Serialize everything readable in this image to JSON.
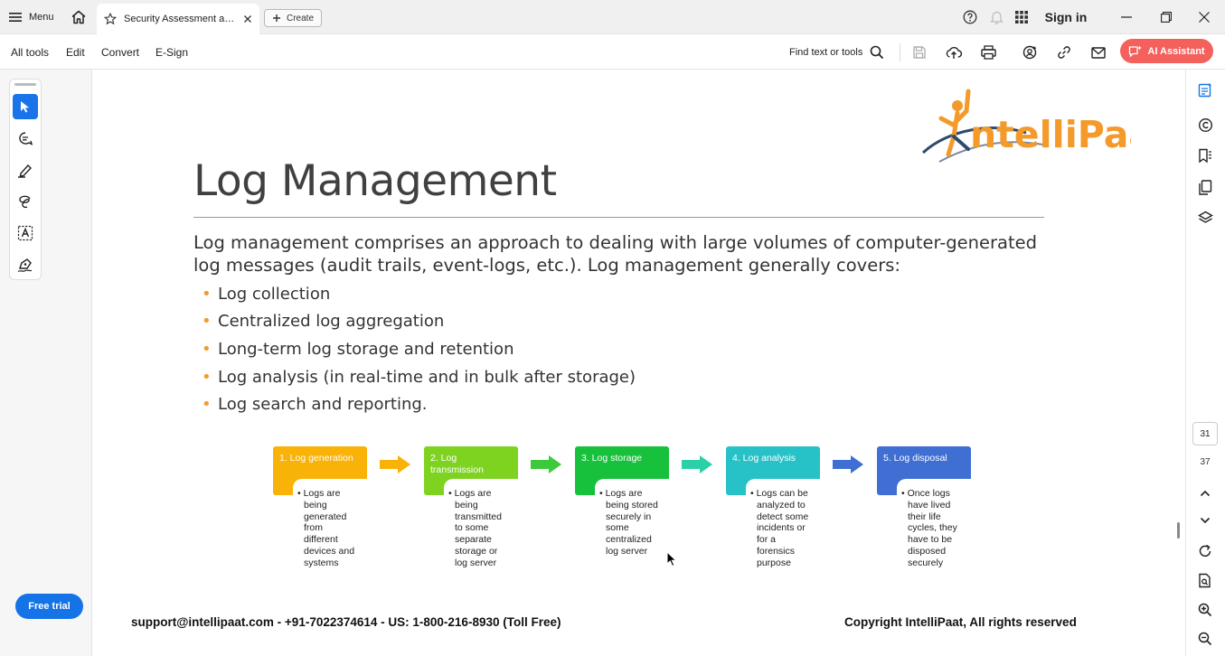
{
  "titlebar": {
    "menu_label": "Menu",
    "tab_label": "Security Assessment and...",
    "create_label": "Create",
    "signin_label": "Sign in"
  },
  "toolbar": {
    "menus": [
      "All tools",
      "Edit",
      "Convert",
      "E-Sign"
    ],
    "find_label": "Find text or tools",
    "ai_label": "AI Assistant"
  },
  "sidebar": {
    "free_trial_label": "Free trial"
  },
  "pager": {
    "current_page": "31",
    "total_pages": "37"
  },
  "slide": {
    "title": "Log Management",
    "intro": "Log management comprises an approach to dealing with large volumes of computer-generated log messages (audit trails, event-logs, etc.). Log management generally covers:",
    "bullets": [
      "Log collection",
      "Centralized log aggregation",
      "Long-term log storage and retention",
      "Log analysis (in real-time and in bulk after storage)",
      "Log search and reporting."
    ],
    "stages": [
      {
        "title": "1. Log generation",
        "color": "#f9b208",
        "desc": [
          "• Logs are",
          "being",
          "generated",
          "from",
          "different",
          "devices and",
          "systems"
        ]
      },
      {
        "title": "2. Log transmission",
        "color": "#7ed321",
        "desc": [
          "• Logs are",
          "being",
          "transmitted",
          "to some",
          "separate",
          "storage or",
          "log server"
        ]
      },
      {
        "title": "3. Log storage",
        "color": "#17c13c",
        "desc": [
          "• Logs are",
          "being stored",
          "securely in",
          "some",
          "centralized",
          "log server"
        ]
      },
      {
        "title": "4. Log analysis",
        "color": "#27c2c8",
        "desc": [
          "• Logs can be",
          "analyzed to",
          "detect some",
          "incidents or",
          "for a",
          "forensics",
          "purpose"
        ]
      },
      {
        "title": "5. Log disposal",
        "color": "#3f6fd2",
        "desc": [
          "• Once logs",
          "have lived",
          "their life",
          "cycles, they",
          "have to be",
          "disposed",
          "securely"
        ]
      }
    ],
    "arrow_colors": [
      "#f9b208",
      "#3cc93c",
      "#2bd0a8",
      "#3f6fd2"
    ],
    "logo_text": "ntelliPaat",
    "footer_left": "support@intellipaat.com - +91-7022374614 - US: 1-800-216-8930 (Toll Free)",
    "footer_right": "Copyright IntelliPaat, All rights reserved"
  },
  "colors": {
    "accent_blue": "#1473e6",
    "ai_red": "#f4605c",
    "bullet_orange": "#f39a2b"
  }
}
